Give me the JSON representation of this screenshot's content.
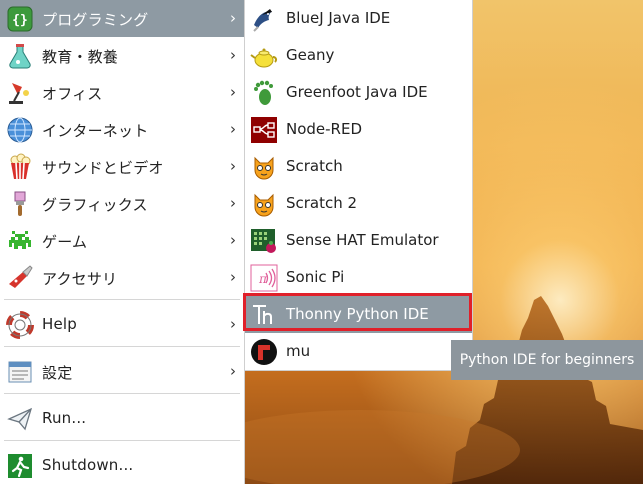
{
  "main_menu": {
    "items": [
      {
        "label": "プログラミング",
        "icon": "programming-icon",
        "has_arrow": true,
        "active": true
      },
      {
        "label": "教育・教養",
        "icon": "education-flask-icon",
        "has_arrow": true
      },
      {
        "label": "オフィス",
        "icon": "office-lamp-icon",
        "has_arrow": true
      },
      {
        "label": "インターネット",
        "icon": "internet-globe-icon",
        "has_arrow": true
      },
      {
        "label": "サウンドとビデオ",
        "icon": "sound-video-popcorn-icon",
        "has_arrow": true
      },
      {
        "label": "グラフィックス",
        "icon": "graphics-brush-icon",
        "has_arrow": true
      },
      {
        "label": "ゲーム",
        "icon": "game-invader-icon",
        "has_arrow": true
      },
      {
        "label": "アクセサリ",
        "icon": "accessories-knife-icon",
        "has_arrow": true
      },
      {
        "label": "Help",
        "icon": "help-lifebuoy-icon",
        "has_arrow": true
      },
      {
        "label": "設定",
        "icon": "settings-icon",
        "has_arrow": true
      },
      {
        "label": "Run...",
        "icon": "run-paperplane-icon",
        "has_arrow": false
      },
      {
        "label": "Shutdown...",
        "icon": "shutdown-exit-icon",
        "has_arrow": false
      }
    ],
    "arrow_glyph": "›"
  },
  "submenu": {
    "items": [
      {
        "label": "BlueJ Java IDE",
        "icon": "bluej-bird-icon"
      },
      {
        "label": "Geany",
        "icon": "geany-teapot-icon"
      },
      {
        "label": "Greenfoot Java IDE",
        "icon": "greenfoot-footprint-icon"
      },
      {
        "label": "Node-RED",
        "icon": "node-red-icon"
      },
      {
        "label": "Scratch",
        "icon": "scratch-cat-icon"
      },
      {
        "label": "Scratch 2",
        "icon": "scratch2-cat-icon"
      },
      {
        "label": "Sense HAT Emulator",
        "icon": "sense-hat-icon"
      },
      {
        "label": "Sonic Pi",
        "icon": "sonic-pi-icon"
      },
      {
        "label": "Thonny Python IDE",
        "icon": "thonny-icon",
        "highlighted": true
      },
      {
        "label": "mu",
        "icon": "mu-icon"
      }
    ]
  },
  "tooltip": {
    "text": "Python IDE for beginners"
  },
  "colors": {
    "highlight_bg": "#8e9aa3",
    "annotation_border": "#e0202a",
    "tooltip_bg": "#8d969d"
  }
}
